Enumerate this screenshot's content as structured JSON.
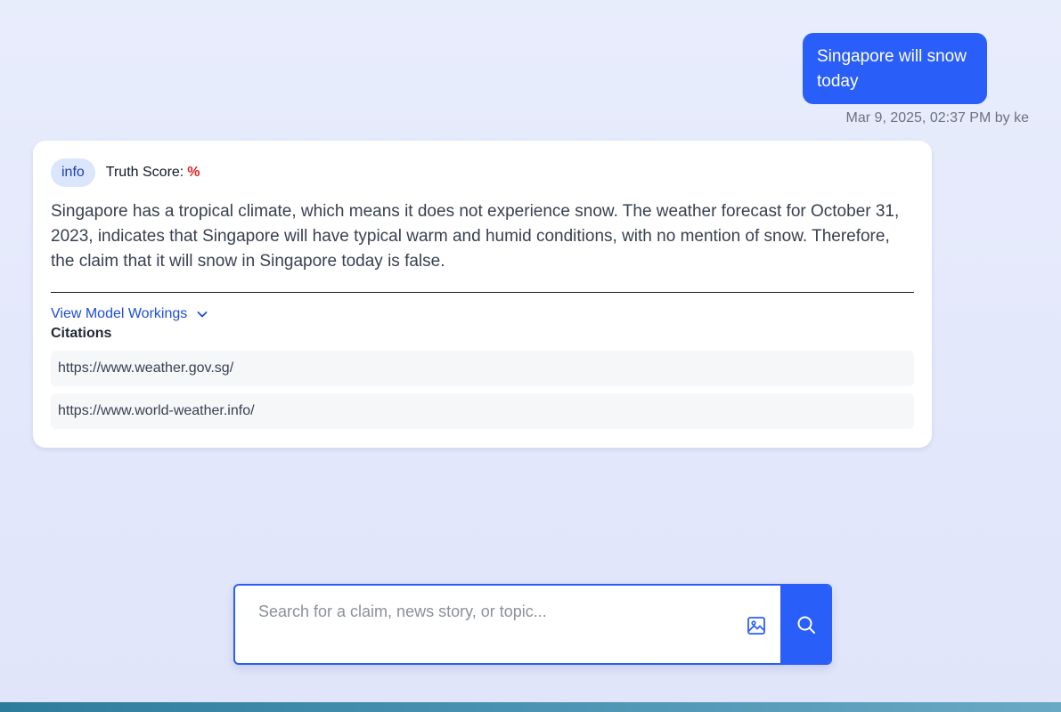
{
  "conversation": {
    "user_message": "Singapore will snow today",
    "user_meta": "Mar 9, 2025, 02:37 PM by ke"
  },
  "result": {
    "badge": "info",
    "truth_score_label": "Truth Score:",
    "truth_score_value": "%",
    "answer": "Singapore has a tropical climate, which means it does not experience snow. The weather forecast for October 31, 2023, indicates that Singapore will have typical warm and humid conditions, with no mention of snow. Therefore, the claim that it will snow in Singapore today is false.",
    "workings_label": "View Model Workings",
    "citations_title": "Citations",
    "citations": [
      "https://www.weather.gov.sg/",
      "https://www.world-weather.info/"
    ]
  },
  "search": {
    "placeholder": "Search for a claim, news story, or topic...",
    "value": ""
  },
  "icons": {
    "workings_toggle": "chevron-down-icon",
    "image_upload": "image-icon",
    "search": "search-icon"
  },
  "colors": {
    "accent": "#2a5ef8",
    "truth_score": "#dc2626",
    "link": "#1d4ed8"
  }
}
